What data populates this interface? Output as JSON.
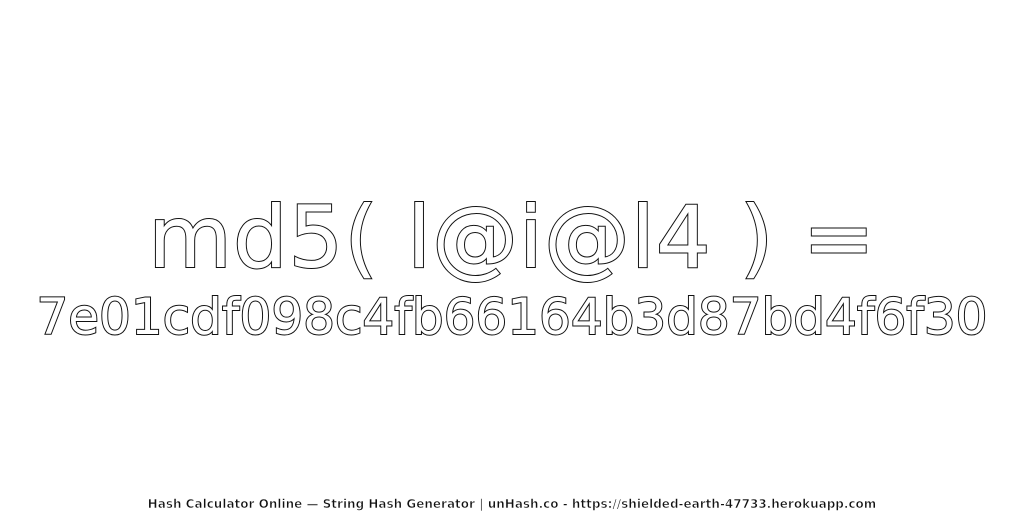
{
  "expression": "md5( l@i@l4 ) =",
  "hash": "7e01cdf098c4fb66164b3d87bd4f6f30",
  "footer": "Hash Calculator Online — String Hash Generator | unHash.co - https://shielded-earth-47733.herokuapp.com",
  "colors": {
    "background": "#ffffff",
    "text_fill": "#ffffff",
    "text_outline": "#111111"
  }
}
